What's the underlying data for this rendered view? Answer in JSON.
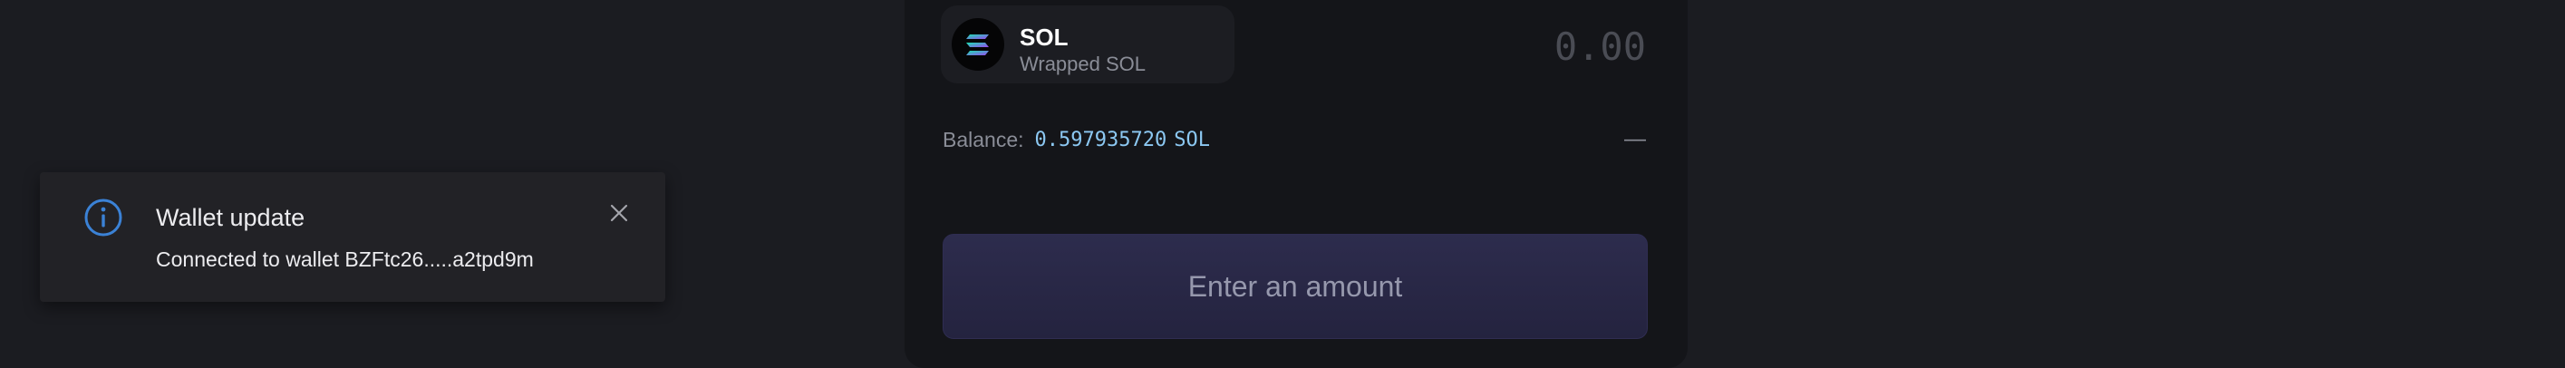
{
  "swap": {
    "token": {
      "symbol": "SOL",
      "name": "Wrapped SOL",
      "icon": "solana-logo-icon"
    },
    "amount_placeholder": "0.00",
    "balance": {
      "label": "Balance:",
      "value": "0.597935720",
      "unit": "SOL",
      "trailing": "—"
    },
    "submit_label": "Enter an amount"
  },
  "toast": {
    "icon": "info-icon",
    "title": "Wallet update",
    "message": "Connected to wallet BZFtc26.....a2tpd9m",
    "close_icon": "close-icon"
  },
  "colors": {
    "background": "#1b1c21",
    "panel": "#141519",
    "accent_blue": "#8cc8f2",
    "button_gradient_top": "#2d2c4d",
    "button_gradient_bottom": "#24233f",
    "info_blue": "#3b82d6"
  }
}
